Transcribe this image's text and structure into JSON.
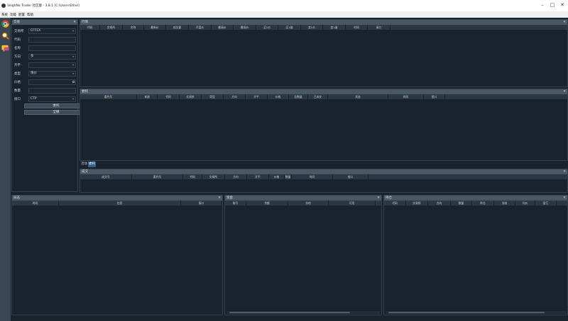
{
  "window": {
    "title": "VeighNa Trader 社区版 - 3.8.1   [C:\\Users\\Ethel]",
    "minimize_glyph": "–",
    "maximize_glyph": "□",
    "close_glyph": "✕"
  },
  "menu": [
    "系统",
    "功能",
    "配置",
    "帮助"
  ],
  "left_toolbar": [
    "chrome-icon",
    "search-icon",
    "chat-icon"
  ],
  "trade_panel": {
    "title": "交易",
    "close": "✕",
    "fields": [
      {
        "label": "交易所",
        "value": "CFFEX",
        "kind": "select"
      },
      {
        "label": "代码",
        "value": "",
        "kind": "input"
      },
      {
        "label": "名称",
        "value": "",
        "kind": "readonly"
      },
      {
        "label": "方向",
        "value": "多",
        "kind": "select"
      },
      {
        "label": "开平",
        "value": "",
        "kind": "select"
      },
      {
        "label": "类型",
        "value": "限价",
        "kind": "select"
      },
      {
        "label": "价格",
        "value": "",
        "kind": "check"
      },
      {
        "label": "数量",
        "value": "",
        "kind": "input"
      },
      {
        "label": "接口",
        "value": "CTP",
        "kind": "select"
      }
    ],
    "buttons": [
      "委托",
      "全撤"
    ]
  },
  "tick_panel": {
    "title": "行情",
    "close": "✕",
    "columns": [
      "代码",
      "交易所",
      "名称",
      "最新价",
      "成交量",
      "开盘价",
      "最高价",
      "最低价",
      "买1价",
      "买1量",
      "卖1价",
      "卖1量",
      "时间",
      "接口"
    ]
  },
  "order_panel": {
    "title": "委托",
    "close": "✕",
    "columns": [
      "委托号",
      "来源",
      "代码",
      "交易所",
      "类型",
      "方向",
      "开平",
      "价格",
      "总数量",
      "已成交",
      "状态",
      "时间",
      "接口"
    ]
  },
  "bottom_tabs": [
    "活动",
    "委托"
  ],
  "trade_list_panel": {
    "title": "成交",
    "close": "✕",
    "columns": [
      "成交号",
      "委托号",
      "代码",
      "交易所",
      "方向",
      "开平",
      "价格",
      "数量",
      "时间",
      "接口"
    ]
  },
  "log_panel": {
    "title": "日志",
    "close": "✕",
    "columns": [
      "时间",
      "信息",
      "接口"
    ]
  },
  "account_panel": {
    "title": "资金",
    "close": "✕",
    "columns": [
      "账号",
      "余额",
      "冻结",
      "可用"
    ]
  },
  "position_panel": {
    "title": "持仓",
    "close": "✕",
    "columns": [
      "代码",
      "交易所",
      "方向",
      "数量",
      "昨仓",
      "冻结",
      "均价",
      "盈亏"
    ]
  },
  "colors": {
    "background": "#1a222c",
    "panel_title": "#4a5866",
    "header": "#2b3743",
    "active_tab": "#2f5f8a"
  }
}
